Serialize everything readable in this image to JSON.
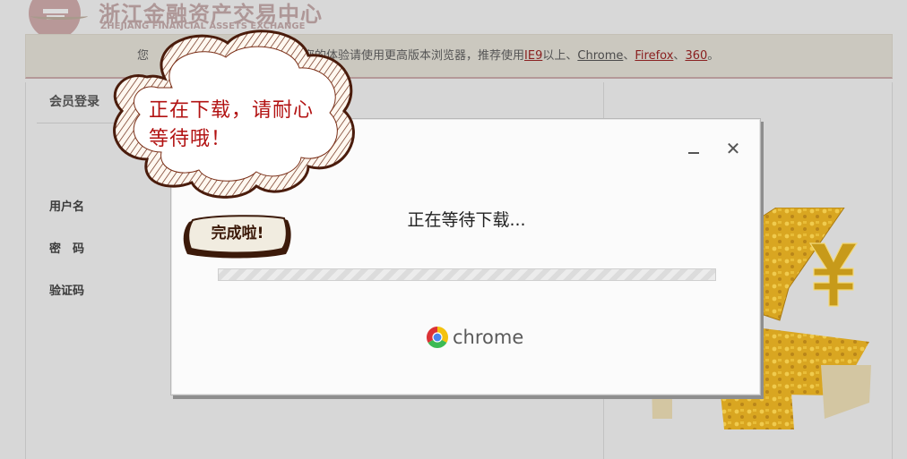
{
  "header": {
    "logo_cn": "浙江金融资产交易中心",
    "logo_en": "ZHEJIANG FINANCIAL ASSETS EXCHANGE"
  },
  "notice": {
    "prefix": "您",
    "text": "了不影响您的体验请使用更高版本浏览器，推荐使用",
    "browsers": [
      {
        "label": "IE9",
        "kind": "link"
      },
      {
        "label": "以上、",
        "kind": "text"
      },
      {
        "label": "Chrome",
        "kind": "link-dark"
      },
      {
        "label": "、",
        "kind": "text"
      },
      {
        "label": "Firefox",
        "kind": "link"
      },
      {
        "label": "、",
        "kind": "text"
      },
      {
        "label": "360",
        "kind": "link"
      },
      {
        "label": "。",
        "kind": "text"
      }
    ]
  },
  "login": {
    "title": "会员登录",
    "fields": {
      "username": "用户名",
      "password": "密　码",
      "captcha": "验证码"
    }
  },
  "dialog": {
    "status": "正在等待下载...",
    "progress_fraction": 0,
    "brand": "chrome",
    "min_icon": "minimize-icon",
    "close_icon": "close-icon",
    "close_glyph": "✕"
  },
  "overlay": {
    "cloud_text": "正在下载，请耐心等待哦！",
    "done_label": "完成啦!"
  },
  "colors": {
    "accent_red": "#b21212",
    "notice_link": "#8a2020",
    "gold": "#e0b830",
    "progress": "#4a8ad8"
  }
}
